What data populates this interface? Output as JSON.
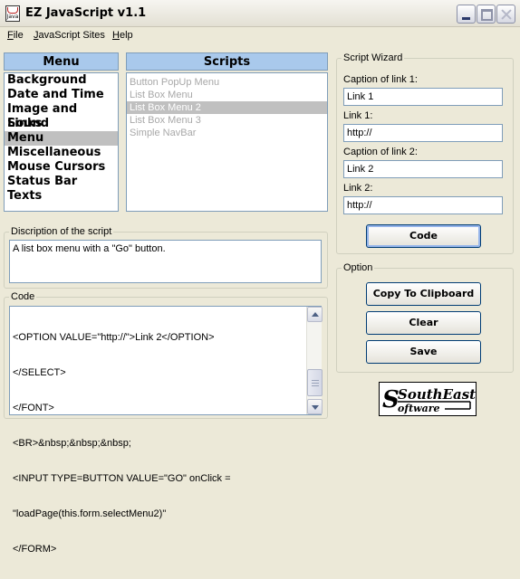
{
  "window": {
    "title": "EZ JavaScript v1.1",
    "icon": "java-cup-icon"
  },
  "menubar": {
    "items": [
      {
        "label": "File",
        "accel": "F",
        "rest": "ile"
      },
      {
        "label": "JavaScript Sites",
        "accel": "J",
        "rest": "avaScript Sites"
      },
      {
        "label": "Help",
        "accel": "H",
        "rest": "elp"
      }
    ]
  },
  "categories": {
    "header": "Menu",
    "items": [
      "Background",
      "Date and Time",
      "Image and Sound",
      "Links",
      "Menu",
      "Miscellaneous",
      "Mouse Cursors",
      "Status Bar",
      "Texts"
    ],
    "selected": "Menu"
  },
  "scripts": {
    "header": "Scripts",
    "items": [
      "Button PopUp Menu",
      "List Box Menu",
      "List Box Menu 2",
      "List Box Menu 3",
      "Simple NavBar"
    ],
    "selected": "List Box Menu 2"
  },
  "description": {
    "label": "Discription of the script",
    "text": "A list box menu with a \"Go\" button."
  },
  "code": {
    "label": "Code",
    "lines": [
      "<OPTION VALUE=\"http://\">Link 2</OPTION>",
      "</SELECT>",
      "</FONT>",
      "<BR>&nbsp;&nbsp;&nbsp;",
      "<INPUT TYPE=BUTTON VALUE=\"GO\" onClick =",
      "\"loadPage(this.form.selectMenu2)\"",
      "</FORM>"
    ]
  },
  "wizard": {
    "title": "Script Wizard",
    "fields": [
      {
        "label": "Caption of link 1:",
        "value": "Link 1"
      },
      {
        "label": "Link 1:",
        "value": "http://"
      },
      {
        "label": "Caption of link 2:",
        "value": "Link 2"
      },
      {
        "label": "Link 2:",
        "value": "http://"
      }
    ],
    "code_button": "Code"
  },
  "option": {
    "title": "Option",
    "copy_button": "Copy To Clipboard",
    "clear_button": "Clear",
    "save_button": "Save"
  },
  "logo": {
    "line1": "SouthEast",
    "line2": "oftware",
    "initial": "S"
  }
}
